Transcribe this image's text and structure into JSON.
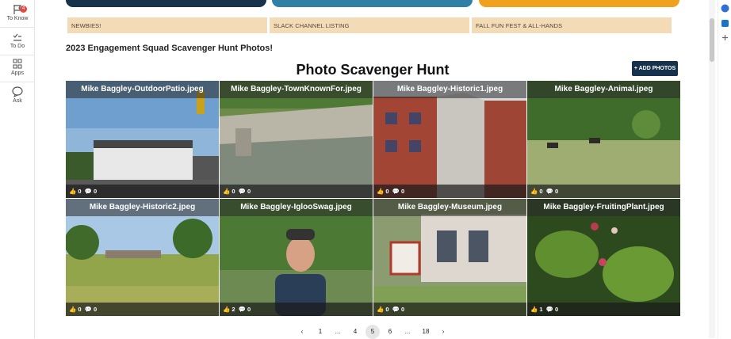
{
  "sidebar": {
    "items": [
      {
        "label": "To Know",
        "badge": "4"
      },
      {
        "label": "To Do"
      },
      {
        "label": "Apps"
      },
      {
        "label": "Ask"
      }
    ]
  },
  "nav": {
    "buttons": [
      "NEWBIES!",
      "SLACK CHANNEL LISTING",
      "FALL FUN FEST & ALL-HANDS"
    ]
  },
  "page": {
    "subtitle": "2023 Engagement Squad Scavenger Hunt Photos!",
    "title": "Photo Scavenger Hunt",
    "add_photos_label": "+ ADD PHOTOS"
  },
  "photos": [
    {
      "caption": "Mike Baggley-OutdoorPatio.jpeg",
      "likes": "0",
      "comments": "0"
    },
    {
      "caption": "Mike Baggley-TownKnownFor.jpeg",
      "likes": "0",
      "comments": "0"
    },
    {
      "caption": "Mike Baggley-Historic1.jpeg",
      "likes": "0",
      "comments": "0"
    },
    {
      "caption": "Mike Baggley-Animal.jpeg",
      "likes": "0",
      "comments": "0"
    },
    {
      "caption": "Mike Baggley-Historic2.jpeg",
      "likes": "0",
      "comments": "0"
    },
    {
      "caption": "Mike Baggley-IglooSwag.jpeg",
      "likes": "2",
      "comments": "0"
    },
    {
      "caption": "Mike Baggley-Museum.jpeg",
      "likes": "0",
      "comments": "0"
    },
    {
      "caption": "Mike Baggley-FruitingPlant.jpeg",
      "likes": "1",
      "comments": "0"
    }
  ],
  "pagination": {
    "prev": "‹",
    "next": "›",
    "pages": [
      "1",
      "...",
      "4",
      "5",
      "6",
      "...",
      "18"
    ],
    "current": "5"
  },
  "colors": {
    "top_dark": "#17324d",
    "top_blue": "#2f7fa6",
    "top_orange": "#f0a21e",
    "nav_bg": "#f4dbb8"
  }
}
